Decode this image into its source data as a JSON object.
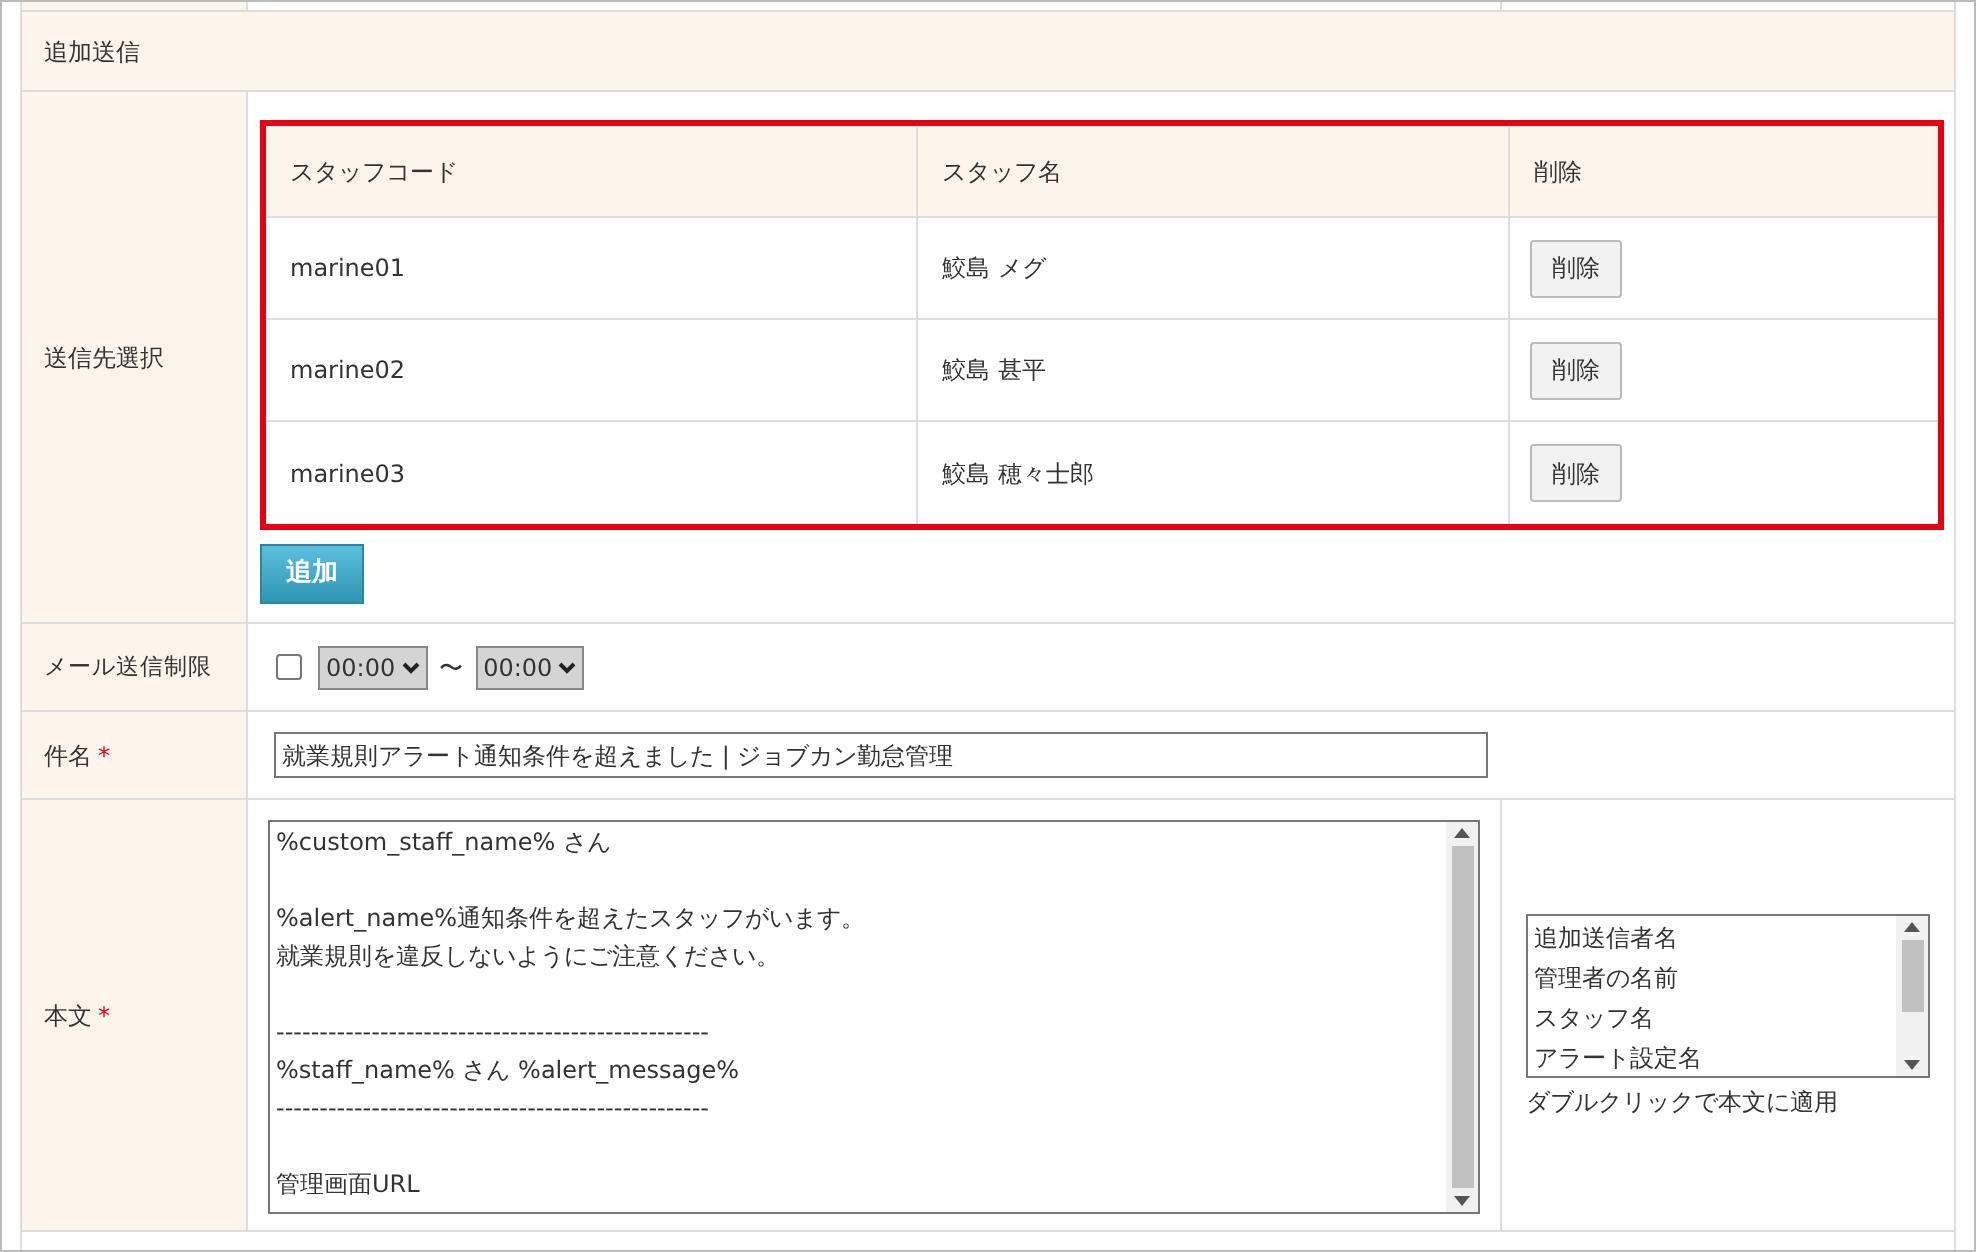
{
  "section_title": "追加送信",
  "recipients": {
    "label": "送信先選択",
    "columns": [
      "スタッフコード",
      "スタッフ名",
      "削除"
    ],
    "rows": [
      {
        "code": "marine01",
        "name": "鮫島 メグ",
        "action": "削除"
      },
      {
        "code": "marine02",
        "name": "鮫島 甚平",
        "action": "削除"
      },
      {
        "code": "marine03",
        "name": "鮫島 穂々士郎",
        "action": "削除"
      }
    ],
    "add_button": "追加"
  },
  "mail_limit": {
    "label": "メール送信制限",
    "checked": false,
    "from": "00:00",
    "separator": "〜",
    "to": "00:00"
  },
  "subject": {
    "label": "件名",
    "required_mark": "*",
    "value": "就業規則アラート通知条件を超えました | ジョブカン勤怠管理"
  },
  "body": {
    "label": "本文",
    "required_mark": "*",
    "lines": [
      {
        "kind": "text",
        "text": "%custom_staff_name% さん"
      },
      {
        "kind": "blank"
      },
      {
        "kind": "text",
        "text": "%alert_name%通知条件を超えたスタッフがいます。"
      },
      {
        "kind": "text",
        "text": "就業規則を違反しないようにご注意ください。"
      },
      {
        "kind": "blank"
      },
      {
        "kind": "text",
        "text": "--------------------------------------------------"
      },
      {
        "kind": "text",
        "text": "%staff_name% さん %alert_message%"
      },
      {
        "kind": "text",
        "text": "--------------------------------------------------"
      },
      {
        "kind": "blank"
      },
      {
        "kind": "text",
        "text": "管理画面URL"
      }
    ],
    "variables": [
      {
        "label": "追加送信者名",
        "selected": false
      },
      {
        "label": "管理者の名前",
        "selected": false
      },
      {
        "label": "スタッフ名",
        "selected": false
      },
      {
        "label": "アラート設定名",
        "selected": false
      }
    ],
    "hint": "ダブルクリックで本文に適用"
  }
}
